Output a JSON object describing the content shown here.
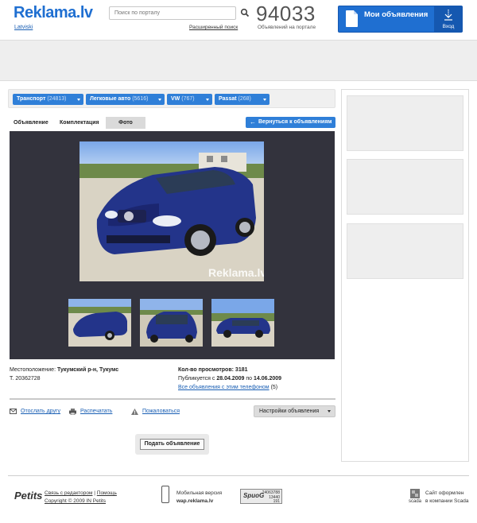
{
  "header": {
    "logo": "Reklama.lv",
    "language_link": "Latviski",
    "search_placeholder": "Поиск по порталу",
    "advanced_search": "Расширенный поиск",
    "ads_count": "94033",
    "ads_count_label": "Объявлений на портале",
    "my_ads_label": "Мои объявления",
    "login_label": "Вход"
  },
  "breadcrumbs": [
    {
      "label": "Транспорт",
      "count": "(24813)"
    },
    {
      "label": "Легковые авто",
      "count": "(5616)"
    },
    {
      "label": "VW",
      "count": "(767)"
    },
    {
      "label": "Passat",
      "count": "(268)"
    }
  ],
  "tabs": [
    "Объявление",
    "Комплектация",
    "Фото"
  ],
  "active_tab": "Фото",
  "back_button": "Вернуться к объявлениям",
  "photo": {
    "watermark": "Reklama.lv",
    "thumbnail_count": 3
  },
  "details": {
    "location_label": "Местоположение:",
    "location_value": "Тукумский р-н, Тукумс",
    "phone": "Т. 20362728",
    "views_label": "Кол-во просмотров:",
    "views_value": "3181",
    "published_prefix": "Публикуется с",
    "published_from": "28.04.2009",
    "published_mid": "по",
    "published_to": "14.06.2009",
    "phone_ads_link": "Все объявления с этим телефоном",
    "phone_ads_count": "(5)"
  },
  "actions": {
    "send_friend": "Отослать другу",
    "print": "Распечатать",
    "complain": "Пожаловаться",
    "settings": "Настройки объявления"
  },
  "submit_button": "Подать объявление",
  "footer": {
    "logo": "Petits",
    "contact": "Связь с редактором",
    "help": "Помощь",
    "copyright": "Copyright © 2009 IN Petits",
    "mobile_label": "Мобильная версия",
    "mobile_url": "wap.reklama.lv",
    "counter_brand": "SpuoG",
    "counter_numbers": [
      "24063788",
      "13440",
      "191"
    ],
    "scada_icon_label": "scada",
    "scada_line1": "Сайт оформлен",
    "scada_line2": "в компании Scada"
  },
  "colors": {
    "brand_blue": "#1f6fd1",
    "button_blue": "#2f7fd8",
    "gallery_bg": "#33333d"
  }
}
